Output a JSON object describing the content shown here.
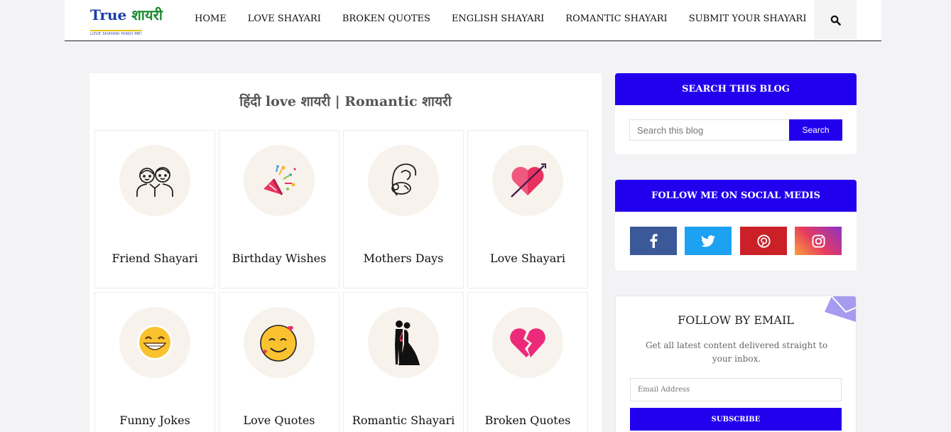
{
  "brand": {
    "logo_en": "True",
    "logo_hi": "शायरी",
    "tagline": "LOVE SHAYARI HINDI ME!"
  },
  "nav": [
    "HOME",
    "LOVE SHAYARI",
    "BROKEN QUOTES",
    "ENGLISH SHAYARI",
    "ROMANTIC SHAYARI",
    "SUBMIT YOUR SHAYARI"
  ],
  "main": {
    "title": "हिंदी love शायरी | Romantic शायरी",
    "tiles": [
      {
        "label": "Friend Shayari",
        "icon": "friends-icon"
      },
      {
        "label": "Birthday Wishes",
        "icon": "party-popper-icon"
      },
      {
        "label": "Mothers Days",
        "icon": "mother-child-icon"
      },
      {
        "label": "Love Shayari",
        "icon": "heart-arrow-icon"
      },
      {
        "label": "Funny Jokes",
        "icon": "grin-face-icon"
      },
      {
        "label": "Love Quotes",
        "icon": "smiling-face-hearts-icon"
      },
      {
        "label": "Romantic Shayari",
        "icon": "couple-icon"
      },
      {
        "label": "Broken Quotes",
        "icon": "broken-heart-icon"
      }
    ]
  },
  "sidebar": {
    "search": {
      "heading": "SEARCH THIS BLOG",
      "placeholder": "Search this blog",
      "button": "Search"
    },
    "social": {
      "heading": "FOLLOW ME ON SOCIAL MEDIS",
      "items": [
        "facebook-icon",
        "twitter-icon",
        "pinterest-icon",
        "instagram-icon"
      ]
    },
    "email": {
      "heading": "FOLLOW BY EMAIL",
      "description": "Get all latest content delivered straight to your inbox.",
      "placeholder": "Email Address",
      "button": "SUBSCRIBE"
    }
  },
  "colors": {
    "accent": "#2200ee",
    "facebook": "#3b5998",
    "twitter": "#1da1f2",
    "pinterest": "#cb2027",
    "circle_bg": "#f8f2ec"
  }
}
